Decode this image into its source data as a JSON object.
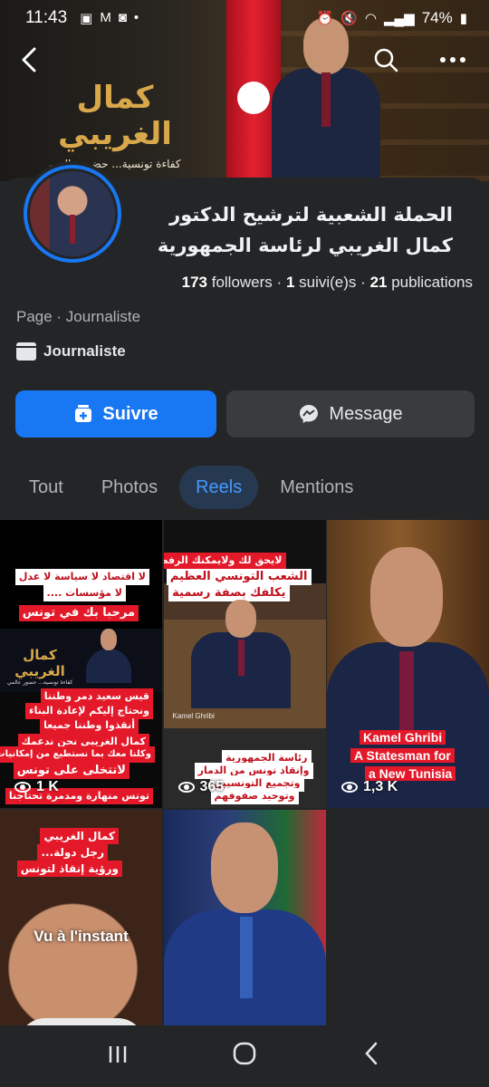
{
  "status_bar": {
    "time": "11:43",
    "battery": "74%",
    "left_icons": [
      "image-icon",
      "mail-icon",
      "instagram-icon",
      "dot-icon"
    ],
    "right_icons": [
      "alarm-icon",
      "mute-icon",
      "wifi-icon",
      "signal-icon",
      "battery-icon"
    ]
  },
  "cover": {
    "title": "كمال الغريبي",
    "tagline": "كفاءة تونسية... حضور عالمي"
  },
  "profile": {
    "name": "الحملة الشعبية لترشيح الدكتور كمال الغريبي لرئاسة الجمهورية",
    "followers_count": "173",
    "followers_label": "followers",
    "following_count": "1",
    "following_label": "suivi(e)s",
    "posts_count": "21",
    "posts_label": "publications",
    "category": "Page · Journaliste",
    "detail": "Journaliste"
  },
  "actions": {
    "follow_label": "Suivre",
    "message_label": "Message"
  },
  "tabs": [
    {
      "label": "Tout",
      "active": false
    },
    {
      "label": "Photos",
      "active": false
    },
    {
      "label": "Reels",
      "active": true
    },
    {
      "label": "Mentions",
      "active": false
    }
  ],
  "reels": [
    {
      "views": "1 K",
      "captions": [
        "لا اقتصاد لا سياسة لا عدل",
        "لا مؤسسات ....",
        "مرحبا بك في تونس",
        "قيس سعيد دمر وطننا",
        "ونحتاج إليكم لإعادة البناء",
        "أنقذوا وطننا جميعا",
        "كمال الغريبي نحن ندعمك",
        "وكلنا معك بما نستطيع من إمكانيات",
        "لاتتخلى على تونس",
        "تونس منهارة ومدمرة تحتاجنا"
      ],
      "cover_title": "كمال الغريبي",
      "cover_sub": "كفاءة تونسية... حضور عالمي"
    },
    {
      "views": "365",
      "captions": [
        "لايحق لك ولايمكنك الرفض",
        "الشعب التونسي العظيم",
        "يكلفك بصفة رسمية",
        "رئاسة الجمهورية",
        "وإنقاذ تونس من الدمار",
        "وتجميع التونسيين",
        "وتوحيد صفوفهم"
      ],
      "name_card": "Kamel Ghribi"
    },
    {
      "views": "1,3 K",
      "captions": [
        "Kamel Ghribi",
        "A Statesman for",
        "a New Tunisia"
      ]
    },
    {
      "views": "",
      "overlay": "Vu à l'instant",
      "captions": [
        "كمال الغريبي",
        "رجل دولة...",
        "ورؤية إنقاذ لتونس"
      ]
    },
    {
      "views": "",
      "captions": []
    }
  ],
  "system_nav": {
    "recents": "|||",
    "home": "◯",
    "back": "‹"
  },
  "colors": {
    "accent": "#1877f2",
    "background": "#242526",
    "active_tab_bg": "#263951",
    "active_tab_text": "#4599ff",
    "caption_red": "#e3192a"
  }
}
